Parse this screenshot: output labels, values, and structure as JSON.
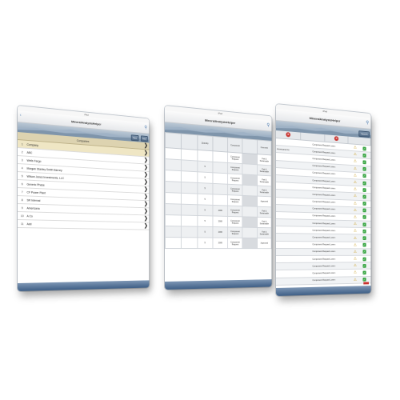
{
  "screen1": {
    "status": "iPad",
    "title": "MineralAnalysisHelper",
    "hero_buttons": [
      "Tabs",
      "Add"
    ],
    "list_header": "Companies",
    "rows": [
      {
        "index": "1",
        "name": "Company"
      },
      {
        "index": "2",
        "name": "ABC"
      },
      {
        "index": "3",
        "name": "Wells Fargo"
      },
      {
        "index": "4",
        "name": "Morgan Stanley Smith Barney"
      },
      {
        "index": "5",
        "name": "Wilson Jones Investments, LLC"
      },
      {
        "index": "6",
        "name": "Generic Phase"
      },
      {
        "index": "7",
        "name": "CF Power Plant"
      },
      {
        "index": "8",
        "name": "SR Internal"
      },
      {
        "index": "9",
        "name": "Americana"
      },
      {
        "index": "10",
        "name": "A Co"
      },
      {
        "index": "11",
        "name": "Add"
      }
    ]
  },
  "screen2": {
    "status": "iPad",
    "title": "MineralAnalysisHelper",
    "headers": [
      "",
      "",
      "Quantity",
      "",
      "Component",
      "",
      "Comment"
    ],
    "rows": [
      [
        "",
        "",
        "",
        "",
        "Component Request",
        "",
        "Fair & Sustainable"
      ],
      [
        "",
        "",
        "5",
        "",
        "Component Request",
        "",
        "Fair & Sustainable"
      ],
      [
        "",
        "",
        "5",
        "",
        "Component Request",
        "",
        "Fair & Sustainable"
      ],
      [
        "",
        "",
        "5",
        "",
        "Component Request",
        "",
        "Fair & Sustainable"
      ],
      [
        "",
        "",
        "5",
        "",
        "Component Request",
        "",
        "Approved"
      ],
      [
        "",
        "",
        "5",
        "2000",
        "Component Request",
        "",
        "Fair & Sustainable"
      ],
      [
        "",
        "",
        "5",
        "2000",
        "Component Request",
        "",
        "Fair & Sustainable"
      ],
      [
        "",
        "",
        "5",
        "2000",
        "Component Request",
        "",
        "Fair & Sustainable"
      ],
      [
        "",
        "",
        "5",
        "2000",
        "Component Request",
        "",
        "Approved"
      ]
    ]
  },
  "screen3": {
    "status": "iPad",
    "title": "MineralAnalysisHelper",
    "search_label": "Search",
    "tabs": [
      "",
      "",
      "",
      ""
    ],
    "rows_count_note": "",
    "rows": [
      {
        "name": "",
        "detail": "Component Request Lorem"
      },
      {
        "name": "Americana Inc",
        "detail": "Component Request Lorem"
      },
      {
        "name": "",
        "detail": "Component Request Lorem"
      },
      {
        "name": "",
        "detail": "Component Request Lorem"
      },
      {
        "name": "",
        "detail": "Component Request Lorem"
      },
      {
        "name": "",
        "detail": "Component Request Lorem"
      },
      {
        "name": "",
        "detail": "Component Request Lorem"
      },
      {
        "name": "",
        "detail": "Component Request Lorem"
      },
      {
        "name": "",
        "detail": "Component Request Lorem"
      },
      {
        "name": "",
        "detail": "Component Request Lorem"
      },
      {
        "name": "",
        "detail": "Component Request Lorem"
      },
      {
        "name": "",
        "detail": "Component Request Lorem"
      },
      {
        "name": "",
        "detail": "Component Request Lorem"
      },
      {
        "name": "",
        "detail": "Component Request Lorem"
      },
      {
        "name": "",
        "detail": "Component Request Lorem"
      },
      {
        "name": "",
        "detail": "Component Request Lorem"
      },
      {
        "name": "",
        "detail": "Component Request Lorem"
      },
      {
        "name": "",
        "detail": "Component Request Lorem"
      },
      {
        "name": "",
        "detail": "Component Request Lorem"
      },
      {
        "name": "",
        "detail": "Component Request Lorem"
      }
    ]
  },
  "colors": {
    "header_tan": "#ddd3b0",
    "footer_blue": "#3f5f86",
    "warn_yellow": "#c79a1c",
    "ok_green": "#3aa644",
    "alert_red": "#c8332f"
  },
  "icons": {
    "search": "search-icon",
    "chevron": "chevron-right-icon",
    "warning": "warning-icon",
    "check": "check-icon",
    "cancel": "cancel-icon"
  }
}
